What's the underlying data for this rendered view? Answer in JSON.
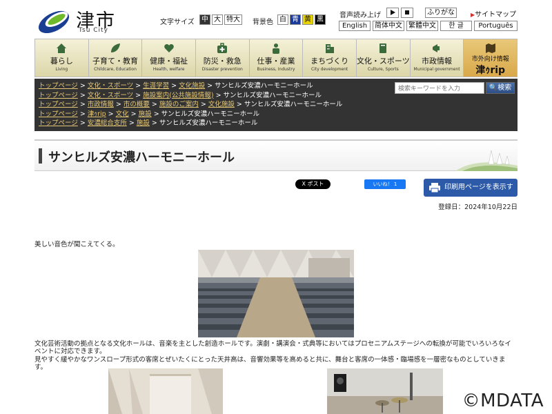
{
  "header": {
    "logo_ja": "津市",
    "logo_en": "Tsu City",
    "font_size_label": "文字サイズ",
    "font_sizes": [
      "中",
      "大",
      "特大"
    ],
    "bg_label": "背景色",
    "bg_options": [
      "白",
      "青",
      "黄",
      "黒"
    ],
    "bg_colors": [
      "#ffffff",
      "#1b3b9a",
      "#e9d300",
      "#000000"
    ],
    "voice_label": "音声読み上げ",
    "furigana": "ふりがな",
    "sitemap": "サイトマップ",
    "languages": [
      "English",
      "简体中文",
      "繁體中文",
      "한 글",
      "Português"
    ]
  },
  "nav": {
    "items": [
      {
        "ja": "暮らし",
        "en": "Living",
        "icon": "house-icon"
      },
      {
        "ja": "子育て・教育",
        "en": "Childcare, Education",
        "icon": "leaf-icon"
      },
      {
        "ja": "健康・福祉",
        "en": "Health, welfare",
        "icon": "heart-icon"
      },
      {
        "ja": "防災・救急",
        "en": "Disaster prevention",
        "icon": "first-aid-icon"
      },
      {
        "ja": "仕事・産業",
        "en": "Business, Industry",
        "icon": "worker-icon"
      },
      {
        "ja": "まちづくり",
        "en": "City development",
        "icon": "building-icon"
      },
      {
        "ja": "文化・スポーツ",
        "en": "Culture, Sports",
        "icon": "book-icon"
      },
      {
        "ja": "市政情報",
        "en": "Municipal government",
        "icon": "megaphone-icon"
      }
    ],
    "special": {
      "line1": "市外向け情報",
      "line2": "津ｩrip",
      "icon": "map-icon"
    }
  },
  "search": {
    "placeholder": "検索キーワードを入力",
    "button": "検索"
  },
  "breadcrumbs": [
    {
      "links": [
        "トップページ",
        "文化・スポーツ",
        "生涯学習",
        "文化施設"
      ],
      "current": "サンヒルズ安濃ハーモニーホール"
    },
    {
      "links": [
        "トップページ",
        "文化・スポーツ",
        "施設案内(公共施設情報)"
      ],
      "current": "サンヒルズ安濃ハーモニーホール"
    },
    {
      "links": [
        "トップページ",
        "市政情報",
        "市の概要",
        "施設のご案内",
        "文化施設"
      ],
      "current": "サンヒルズ安濃ハーモニーホール"
    },
    {
      "links": [
        "トップページ",
        "津ｩrip",
        "文化",
        "施設"
      ],
      "current": "サンヒルズ安濃ハーモニーホール"
    },
    {
      "links": [
        "トップページ",
        "安濃総合支所",
        "施設"
      ],
      "current": "サンヒルズ安濃ハーモニーホール"
    }
  ],
  "page": {
    "title": "サンヒルズ安濃ハーモニーホール",
    "x_post": "X ポスト",
    "fb_like": "いいね！ 1",
    "print_label": "印刷用ページを表示する",
    "registered": "登録日：2024年10月22日",
    "intro": "美しい音色が聞こえてくる。",
    "desc1": "文化芸術活動の拠点となる文化ホールは、音楽を主とした創造ホールです。演劇・講演会・式典等においてはプロセニアムステージへの転換が可能でいろいろなイベントに対応できます。",
    "desc2": "見やすく緩やかなワンスロープ形式の客席とぜいたくにとった天井高は、音響効果等を高めると共に、舞台と客席の一体感・臨場感を一層密なものとしていきます。"
  },
  "watermark": "©MDATA"
}
